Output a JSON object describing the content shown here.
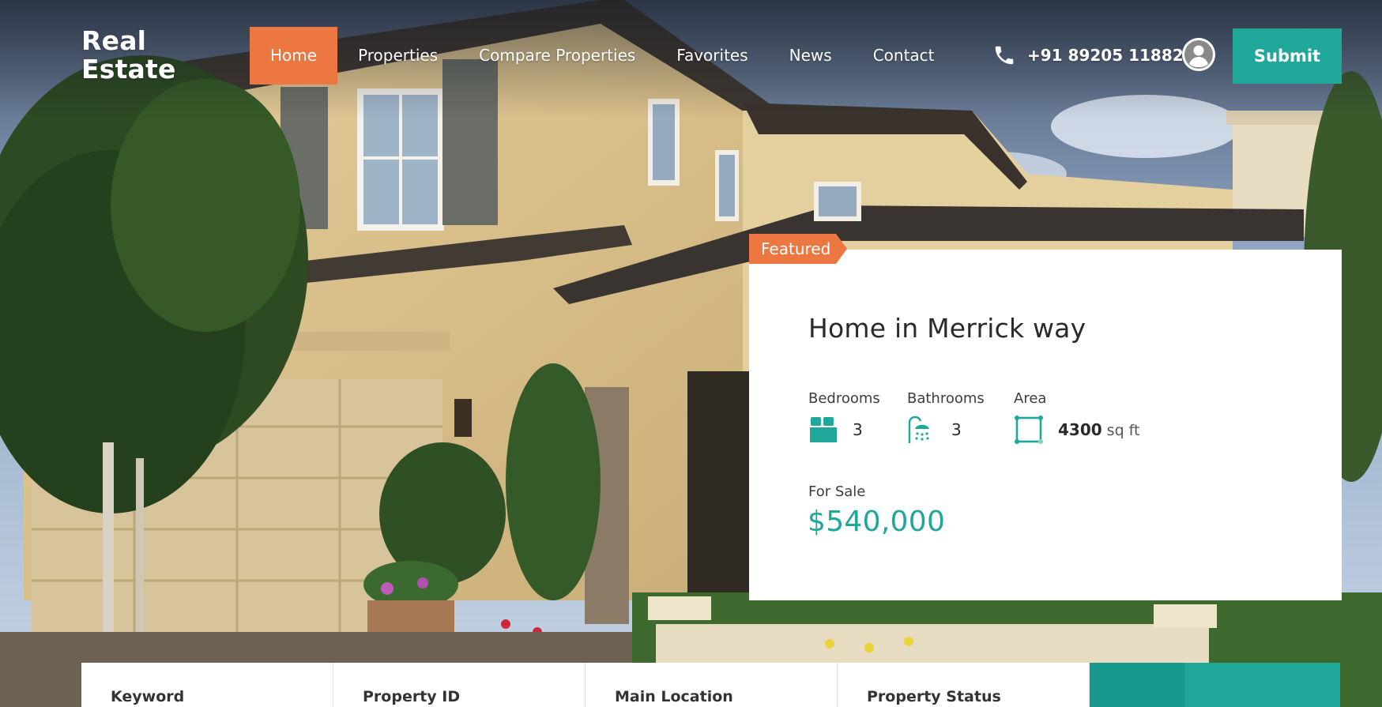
{
  "brand": {
    "line1": "Real",
    "line2": "Estate"
  },
  "nav": {
    "items": [
      {
        "label": "Home",
        "active": true
      },
      {
        "label": "Properties",
        "active": false
      },
      {
        "label": "Compare Properties",
        "active": false
      },
      {
        "label": "Favorites",
        "active": false
      },
      {
        "label": "News",
        "active": false
      },
      {
        "label": "Contact",
        "active": false
      }
    ]
  },
  "header": {
    "phone": "+91 89205 11882",
    "phone_icon": "phone-icon",
    "avatar_icon": "user-avatar-icon",
    "submit_label": "Submit"
  },
  "featured": {
    "badge": "Featured",
    "title": "Home in Merrick way",
    "specs": {
      "bedrooms": {
        "label": "Bedrooms",
        "value": "3",
        "icon": "bed-icon"
      },
      "bathrooms": {
        "label": "Bathrooms",
        "value": "3",
        "icon": "shower-icon"
      },
      "area": {
        "label": "Area",
        "value": "4300",
        "unit": "sq ft",
        "icon": "area-icon"
      }
    },
    "status": "For Sale",
    "price": "$540,000"
  },
  "search": {
    "fields": [
      {
        "label": "Keyword"
      },
      {
        "label": "Property ID"
      },
      {
        "label": "Main Location"
      },
      {
        "label": "Property Status"
      }
    ]
  },
  "colors": {
    "accent_orange": "#ec7740",
    "accent_teal": "#1fa79a",
    "text_dark": "#2a2a2a"
  }
}
